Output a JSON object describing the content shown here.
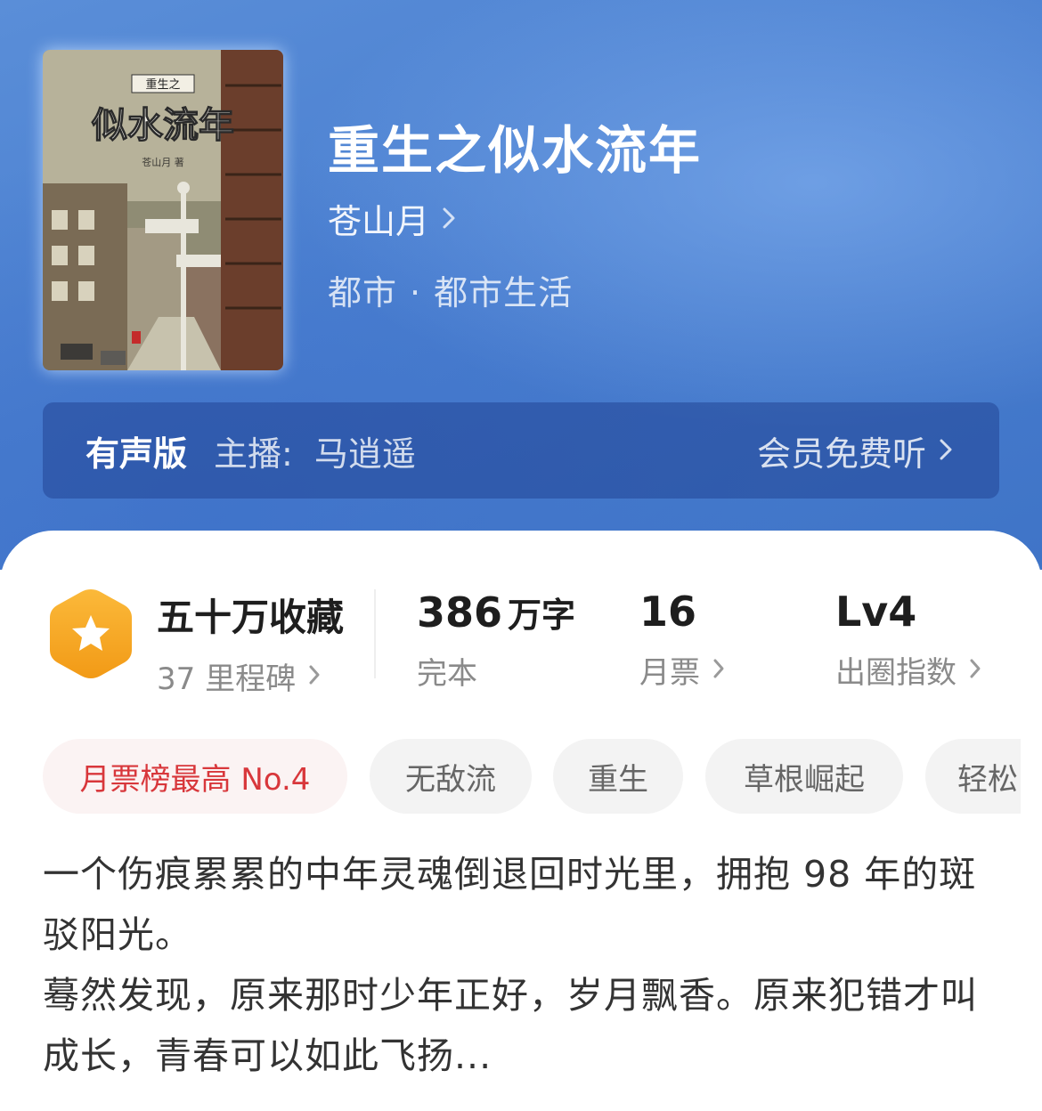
{
  "book": {
    "title": "重生之似水流年",
    "author": "苍山月",
    "category": "都市",
    "subcategory": "都市生活",
    "cover": {
      "series_text": "重生之",
      "title_text": "似水流年",
      "author_text": "苍山月 著"
    }
  },
  "audio": {
    "title": "有声版",
    "host_label": "主播:",
    "host_name": "马逍遥",
    "cta": "会员免费听"
  },
  "stats": {
    "favorites": {
      "main": "五十万收藏",
      "sub": "37 里程碑"
    },
    "words": {
      "value": "386",
      "unit": "万字",
      "sub": "完本"
    },
    "tickets": {
      "value": "16",
      "sub": "月票"
    },
    "influence": {
      "value": "Lv4",
      "sub": "出圈指数"
    }
  },
  "tags": [
    "月票榜最高 No.4",
    "无敌流",
    "重生",
    "草根崛起",
    "轻松"
  ],
  "synopsis": [
    "一个伤痕累累的中年灵魂倒退回时光里，拥抱 98 年的斑驳阳光。",
    "蓦然发现，原来那时少年正好，岁月飘香。原来犯错才叫成长，青春可以如此飞扬..."
  ],
  "colors": {
    "hero": "#4a7fd0",
    "accent_red": "#d8373b",
    "badge_orange": "#f6a521",
    "text_dark": "#1e1e1e",
    "text_grey": "#8a8a8a"
  },
  "icons": {
    "author_chevron": "chevron-right-icon",
    "badge": "star-hexagon-icon"
  }
}
